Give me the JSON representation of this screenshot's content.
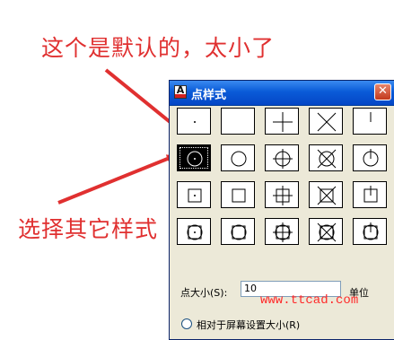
{
  "annotations": {
    "top": "这个是默认的，太小了",
    "bottom": "选择其它样式",
    "color": "#e03030"
  },
  "dialog": {
    "title": "点样式",
    "app_icon": "autocad-app-icon",
    "close_glyph": "✕",
    "point_styles": [
      "dot",
      "none",
      "plus",
      "cross",
      "tick",
      "circle-dot",
      "circle",
      "circle-plus",
      "circle-cross",
      "circle-tick",
      "square-dot",
      "square",
      "square-plus",
      "square-cross",
      "square-tick",
      "circle-square-dot",
      "circle-square",
      "circle-square-plus",
      "circle-square-cross",
      "circle-square-tick"
    ],
    "selected_style": "circle-dot",
    "point_size_label": "点大小(S):",
    "point_size_value": "10",
    "unit_label": "单位",
    "radio_label": "相对于屏幕设置大小(R)"
  },
  "watermark": "www.ttcad.com"
}
